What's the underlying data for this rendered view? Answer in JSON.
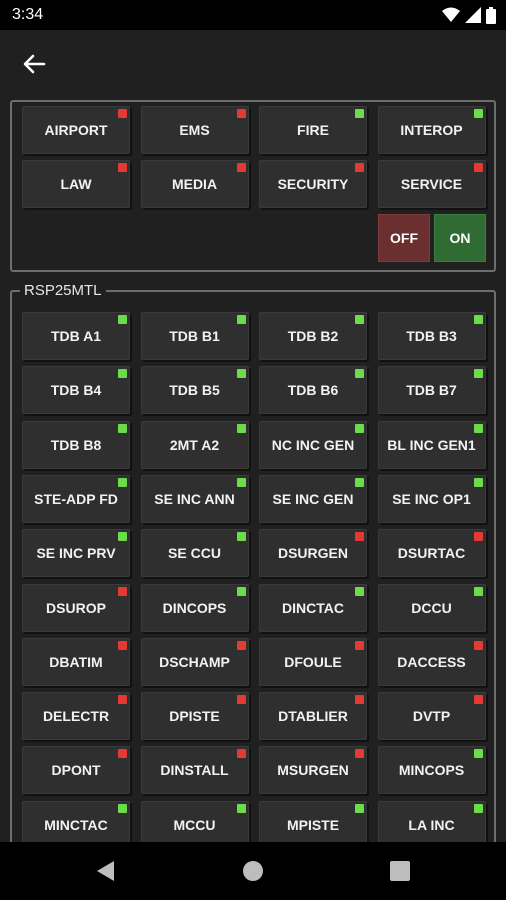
{
  "status_bar": {
    "time": "3:34",
    "icons": [
      "wifi-icon",
      "signal-icon",
      "battery-icon"
    ]
  },
  "app_bar": {
    "back_icon": "arrow-left-icon"
  },
  "colors": {
    "led_red": "#e53935",
    "led_green": "#6bdc4a",
    "off": "#6b2f2f",
    "on": "#2f6b33"
  },
  "top_panel": {
    "buttons": [
      {
        "label": "AIRPORT",
        "led": "red"
      },
      {
        "label": "EMS",
        "led": "red"
      },
      {
        "label": "FIRE",
        "led": "green"
      },
      {
        "label": "INTEROP",
        "led": "green"
      },
      {
        "label": "LAW",
        "led": "red"
      },
      {
        "label": "MEDIA",
        "led": "red"
      },
      {
        "label": "SECURITY",
        "led": "red"
      },
      {
        "label": "SERVICE",
        "led": "red"
      }
    ],
    "off_label": "OFF",
    "on_label": "ON"
  },
  "rsp_panel": {
    "title": "RSP25MTL",
    "buttons": [
      {
        "label": "TDB A1",
        "led": "green"
      },
      {
        "label": "TDB B1",
        "led": "green"
      },
      {
        "label": "TDB B2",
        "led": "green"
      },
      {
        "label": "TDB B3",
        "led": "green"
      },
      {
        "label": "TDB B4",
        "led": "green"
      },
      {
        "label": "TDB B5",
        "led": "green"
      },
      {
        "label": "TDB B6",
        "led": "green"
      },
      {
        "label": "TDB B7",
        "led": "green"
      },
      {
        "label": "TDB B8",
        "led": "green"
      },
      {
        "label": "2MT A2",
        "led": "green"
      },
      {
        "label": "NC INC GEN",
        "led": "green"
      },
      {
        "label": "BL INC GEN1",
        "led": "green"
      },
      {
        "label": "STE-ADP FD",
        "led": "green"
      },
      {
        "label": "SE INC ANN",
        "led": "green"
      },
      {
        "label": "SE INC GEN",
        "led": "green"
      },
      {
        "label": "SE INC OP1",
        "led": "green"
      },
      {
        "label": "SE INC PRV",
        "led": "green"
      },
      {
        "label": "SE CCU",
        "led": "green"
      },
      {
        "label": "DSURGEN",
        "led": "red"
      },
      {
        "label": "DSURTAC",
        "led": "red"
      },
      {
        "label": "DSUROP",
        "led": "red"
      },
      {
        "label": "DINCOPS",
        "led": "green"
      },
      {
        "label": "DINCTAC",
        "led": "green"
      },
      {
        "label": "DCCU",
        "led": "green"
      },
      {
        "label": "DBATIM",
        "led": "red"
      },
      {
        "label": "DSCHAMP",
        "led": "red"
      },
      {
        "label": "DFOULE",
        "led": "red"
      },
      {
        "label": "DACCESS",
        "led": "red"
      },
      {
        "label": "DELECTR",
        "led": "red"
      },
      {
        "label": "DPISTE",
        "led": "red"
      },
      {
        "label": "DTABLIER",
        "led": "red"
      },
      {
        "label": "DVTP",
        "led": "red"
      },
      {
        "label": "DPONT",
        "led": "red"
      },
      {
        "label": "DINSTALL",
        "led": "red"
      },
      {
        "label": "MSURGEN",
        "led": "red"
      },
      {
        "label": "MINCOPS",
        "led": "green"
      },
      {
        "label": "MINCTAC",
        "led": "green"
      },
      {
        "label": "MCCU",
        "led": "green"
      },
      {
        "label": "MPISTE",
        "led": "green"
      },
      {
        "label": "LA INC",
        "led": "green"
      }
    ]
  },
  "nav_bar": {
    "icons": [
      "back-triangle-icon",
      "home-circle-icon",
      "recents-square-icon"
    ]
  }
}
